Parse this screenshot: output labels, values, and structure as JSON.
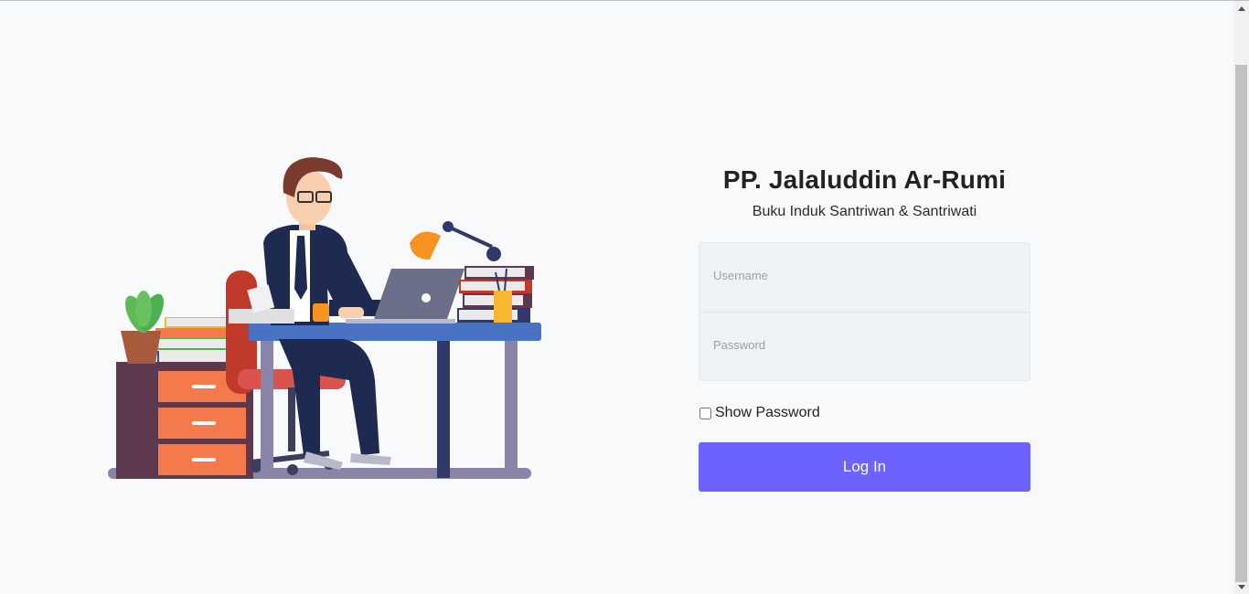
{
  "app": {
    "title": "PP. Jalaluddin Ar-Rumi",
    "subtitle": "Buku Induk Santriwan & Santriwati"
  },
  "form": {
    "username_placeholder": "Username",
    "username_value": "",
    "password_placeholder": "Password",
    "password_value": "",
    "show_password_label": "Show Password",
    "show_password_checked": false,
    "login_label": "Log In"
  },
  "colors": {
    "accent": "#6c63ff",
    "background": "#f8f9fb",
    "field_bg": "#eef2f4"
  },
  "illustration": {
    "icon": "office-worker-illustration"
  }
}
